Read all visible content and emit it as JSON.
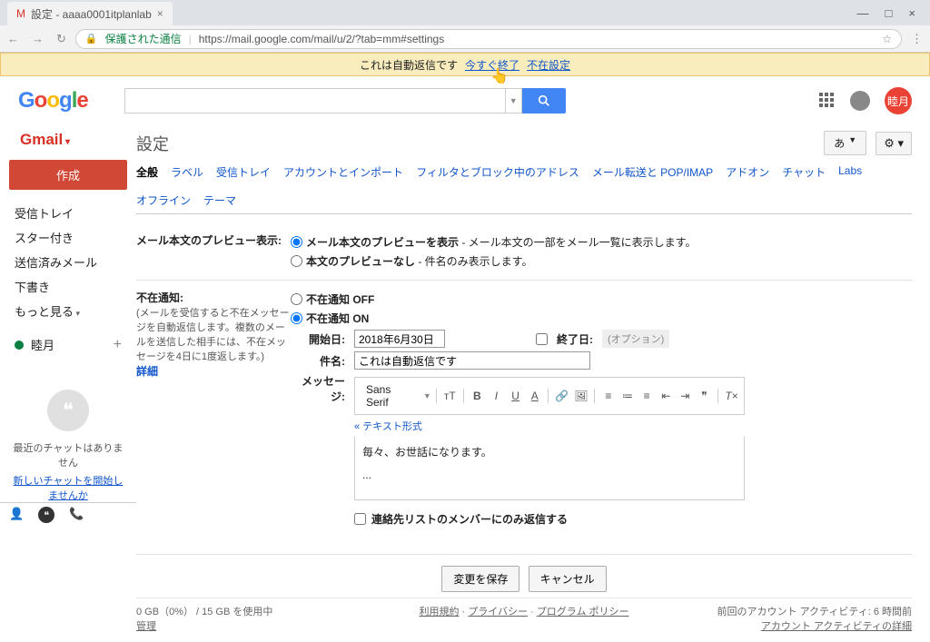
{
  "browser": {
    "tab_title": "設定 - aaaa0001itplanlab",
    "url_secure": "保護された通信",
    "url": "https://mail.google.com/mail/u/2/?tab=mm#settings"
  },
  "banner": {
    "text": "これは自動返信です",
    "end_now": "今すぐ終了",
    "vacation": "不在設定"
  },
  "header": {
    "logo_letters": [
      "G",
      "o",
      "o",
      "g",
      "l",
      "e"
    ],
    "avatar_text": "睦月"
  },
  "sidebar": {
    "gmail": "Gmail",
    "compose": "作成",
    "items": [
      "受信トレイ",
      "スター付き",
      "送信済みメール",
      "下書き",
      "もっと見る"
    ],
    "user_name": "睦月",
    "no_chat": "最近のチャットはありません",
    "new_chat": "新しいチャットを開始しませんか"
  },
  "page": {
    "title": "設定",
    "lang": "あ",
    "tabs": [
      "全般",
      "ラベル",
      "受信トレイ",
      "アカウントとインポート",
      "フィルタとブロック中のアドレス",
      "メール転送と POP/IMAP",
      "アドオン",
      "チャット",
      "Labs",
      "オフライン",
      "テーマ"
    ]
  },
  "preview": {
    "label": "メール本文のプレビュー表示:",
    "opt_show_bold": "メール本文のプレビューを表示",
    "opt_show_rest": " - メール本文の一部をメール一覧に表示します。",
    "opt_hide_bold": "本文のプレビューなし",
    "opt_hide_rest": " - 件名のみ表示します。"
  },
  "vacation": {
    "label": "不在通知:",
    "desc": "(メールを受信すると不在メッセージを自動返信します。複数のメールを送信した相手には、不在メッセージを4日に1度返します。)",
    "details": "詳細",
    "off": "不在通知 OFF",
    "on": "不在通知 ON",
    "start_label": "開始日:",
    "start_value": "2018年6月30日",
    "end_label": "終了日:",
    "end_value": "(オプション)",
    "subject_label": "件名:",
    "subject_value": "これは自動返信です",
    "message_label": "メッセージ:",
    "font": "Sans Serif",
    "text_mode": "« テキスト形式",
    "body": "毎々、お世話になります。",
    "contacts_only": "連絡先リストのメンバーにのみ返信する"
  },
  "buttons": {
    "save": "変更を保存",
    "cancel": "キャンセル"
  },
  "footer": {
    "storage": "0 GB（0%） / 15 GB を使用中",
    "manage": "管理",
    "terms": "利用規約",
    "privacy": "プライバシー",
    "policies": "プログラム ポリシー",
    "activity1": "前回のアカウント アクティビティ: 6 時間前",
    "activity2": "アカウント アクティビティの詳細"
  }
}
